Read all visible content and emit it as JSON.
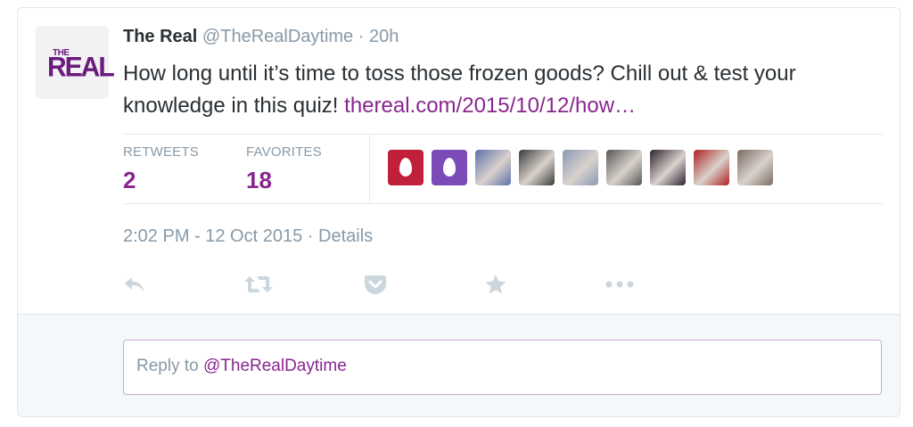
{
  "tweet": {
    "author_name": "The Real",
    "author_handle": "@TheRealDaytime",
    "separator": "·",
    "age": "20h",
    "avatar_logo": {
      "small": "THE",
      "big": "REAL"
    },
    "text": "How long until it’s time to toss those frozen goods? Chill out & test your knowledge in this quiz! ",
    "link_text": "thereal.com/2015/10/12/how…",
    "timestamp": "2:02 PM - 12 Oct 2015",
    "details_sep": " · ",
    "details_label": "Details"
  },
  "stats": {
    "retweets_label": "RETWEETS",
    "retweets_value": "2",
    "favorites_label": "FAVORITES",
    "favorites_value": "18"
  },
  "favoriters": [
    {
      "type": "egg",
      "color": "#c0203a"
    },
    {
      "type": "egg",
      "color": "#7b4bb8"
    },
    {
      "type": "photo",
      "color": "#5c6fa8"
    },
    {
      "type": "photo",
      "color": "#3a3a3a"
    },
    {
      "type": "photo",
      "color": "#8a99b5"
    },
    {
      "type": "photo",
      "color": "#555555"
    },
    {
      "type": "photo",
      "color": "#2c2230"
    },
    {
      "type": "photo",
      "color": "#b02020"
    },
    {
      "type": "photo",
      "color": "#7d6a60"
    }
  ],
  "actions": [
    "reply-icon",
    "retweet-icon",
    "pocket-icon",
    "favorite-star-icon",
    "more-icon"
  ],
  "reply": {
    "prefix": "Reply to ",
    "handle": "@TheRealDaytime"
  },
  "colors": {
    "accent": "#89258f",
    "muted": "#8899a6",
    "text": "#292f33",
    "border": "#e1e8ed",
    "brand_logo": "#6a1b7c"
  }
}
